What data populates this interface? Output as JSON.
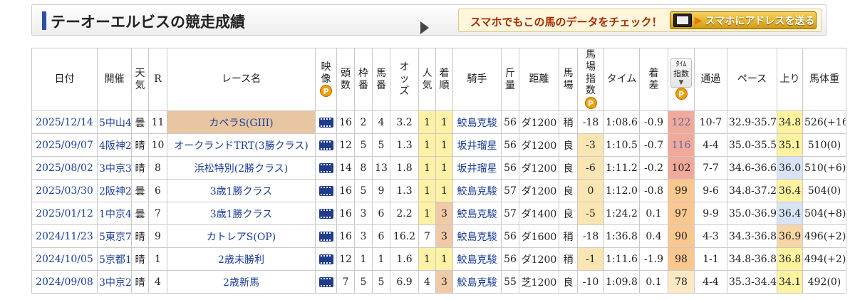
{
  "header": {
    "title": "テーオーエルビスの競走成績",
    "promo_text": "スマホでもこの馬のデータをチェック！",
    "promo_button": "スマホにアドレスを送る"
  },
  "columns": {
    "date": "日付",
    "venue": "開催",
    "weather": "天気",
    "round": "R",
    "race_name": "レース名",
    "video": "映像",
    "field_size": "頭数",
    "gate": "枠番",
    "horse_no": "馬番",
    "odds": "オッズ",
    "popularity": "人気",
    "finish": "着順",
    "jockey": "騎手",
    "weight_carried": "斤量",
    "distance": "距離",
    "track_cond": "馬場",
    "track_index": "馬場指数",
    "time": "タイム",
    "margin": "着差",
    "time_index_small": "ﾀｲﾑ",
    "time_index": "指数",
    "passing": "通過",
    "pace": "ペース",
    "last3f": "上り",
    "body_weight": "馬体重",
    "p_badge": "P"
  },
  "rows": [
    {
      "date": "2025/12/14",
      "venue": "5中山4",
      "weather": "曇",
      "round": "11",
      "race_name": "カペラS(GIII)",
      "field_size": "16",
      "gate": "2",
      "horse_no": "4",
      "odds": "3.2",
      "popularity": "1",
      "finish": "1",
      "jockey": "鮫島克駿",
      "weight_carried": "56",
      "distance": "ダ1200",
      "track_cond": "稍",
      "track_index": "-18",
      "time": "1:08.6",
      "margin": "-0.9",
      "time_index": "122",
      "passing": "10-7",
      "pace": "32.9-35.7",
      "last3f": "34.8",
      "body_weight": "526(+16)"
    },
    {
      "date": "2025/09/07",
      "venue": "4阪神2",
      "weather": "晴",
      "round": "10",
      "race_name": "オークランドTRT(3勝クラス)",
      "field_size": "12",
      "gate": "5",
      "horse_no": "5",
      "odds": "1.3",
      "popularity": "1",
      "finish": "1",
      "jockey": "坂井瑠星",
      "weight_carried": "56",
      "distance": "ダ1200",
      "track_cond": "良",
      "track_index": "-3",
      "time": "1:10.5",
      "margin": "-0.7",
      "time_index": "116",
      "passing": "4-4",
      "pace": "35.0-35.5",
      "last3f": "35.1",
      "body_weight": "510(0)"
    },
    {
      "date": "2025/08/02",
      "venue": "3中京3",
      "weather": "晴",
      "round": "8",
      "race_name": "浜松特別(2勝クラス)",
      "field_size": "14",
      "gate": "8",
      "horse_no": "13",
      "odds": "1.8",
      "popularity": "1",
      "finish": "1",
      "jockey": "坂井瑠星",
      "weight_carried": "56",
      "distance": "ダ1200",
      "track_cond": "良",
      "track_index": "-6",
      "time": "1:11.2",
      "margin": "-0.2",
      "time_index": "102",
      "passing": "7-7",
      "pace": "34.6-36.6",
      "last3f": "36.0",
      "body_weight": "510(+6)"
    },
    {
      "date": "2025/03/30",
      "venue": "2阪神2",
      "weather": "曇",
      "round": "6",
      "race_name": "3歳1勝クラス",
      "field_size": "16",
      "gate": "5",
      "horse_no": "9",
      "odds": "1.3",
      "popularity": "1",
      "finish": "1",
      "jockey": "鮫島克駿",
      "weight_carried": "57",
      "distance": "ダ1200",
      "track_cond": "良",
      "track_index": "0",
      "time": "1:12.0",
      "margin": "-0.8",
      "time_index": "99",
      "passing": "9-6",
      "pace": "34.8-37.2",
      "last3f": "36.4",
      "body_weight": "504(0)"
    },
    {
      "date": "2025/01/12",
      "venue": "1中京4",
      "weather": "曇",
      "round": "7",
      "race_name": "3歳1勝クラス",
      "field_size": "16",
      "gate": "3",
      "horse_no": "6",
      "odds": "2.2",
      "popularity": "1",
      "finish": "3",
      "jockey": "鮫島克駿",
      "weight_carried": "57",
      "distance": "ダ1400",
      "track_cond": "良",
      "track_index": "-5",
      "time": "1:24.2",
      "margin": "0.1",
      "time_index": "97",
      "passing": "9-9",
      "pace": "35.0-36.9",
      "last3f": "36.4",
      "body_weight": "504(+8)"
    },
    {
      "date": "2024/11/23",
      "venue": "5東京7",
      "weather": "晴",
      "round": "9",
      "race_name": "カトレアS(OP)",
      "field_size": "16",
      "gate": "3",
      "horse_no": "6",
      "odds": "16.2",
      "popularity": "7",
      "finish": "3",
      "jockey": "鮫島克駿",
      "weight_carried": "56",
      "distance": "ダ1600",
      "track_cond": "稍",
      "track_index": "-18",
      "time": "1:36.8",
      "margin": "0.4",
      "time_index": "90",
      "passing": "4-3",
      "pace": "34.3-36.8",
      "last3f": "36.9",
      "body_weight": "496(+2)"
    },
    {
      "date": "2024/10/05",
      "venue": "5京都1",
      "weather": "晴",
      "round": "1",
      "race_name": "2歳未勝利",
      "field_size": "12",
      "gate": "1",
      "horse_no": "1",
      "odds": "1.6",
      "popularity": "1",
      "finish": "1",
      "jockey": "鮫島克駿",
      "weight_carried": "56",
      "distance": "ダ1200",
      "track_cond": "稍",
      "track_index": "-1",
      "time": "1:11.6",
      "margin": "-1.9",
      "time_index": "98",
      "passing": "1-1",
      "pace": "34.8-36.8",
      "last3f": "36.8",
      "body_weight": "494(+2)"
    },
    {
      "date": "2024/09/08",
      "venue": "3中京2",
      "weather": "晴",
      "round": "4",
      "race_name": "2歳新馬",
      "field_size": "7",
      "gate": "5",
      "horse_no": "5",
      "odds": "6.9",
      "popularity": "4",
      "finish": "3",
      "jockey": "鮫島克駿",
      "weight_carried": "55",
      "distance": "芝1200",
      "track_cond": "良",
      "track_index": "-10",
      "time": "1:09.8",
      "margin": "0.1",
      "time_index": "78",
      "passing": "4-4",
      "pace": "35.3-34.4",
      "last3f": "34.1",
      "body_weight": "492(0)"
    }
  ],
  "colors": {
    "accent_bar": "#2b4fa8",
    "link": "#1a3c9a",
    "top_popularity": "#fff2a6",
    "third_place": "#f0c9a6",
    "p_badge": "#f0a000"
  }
}
